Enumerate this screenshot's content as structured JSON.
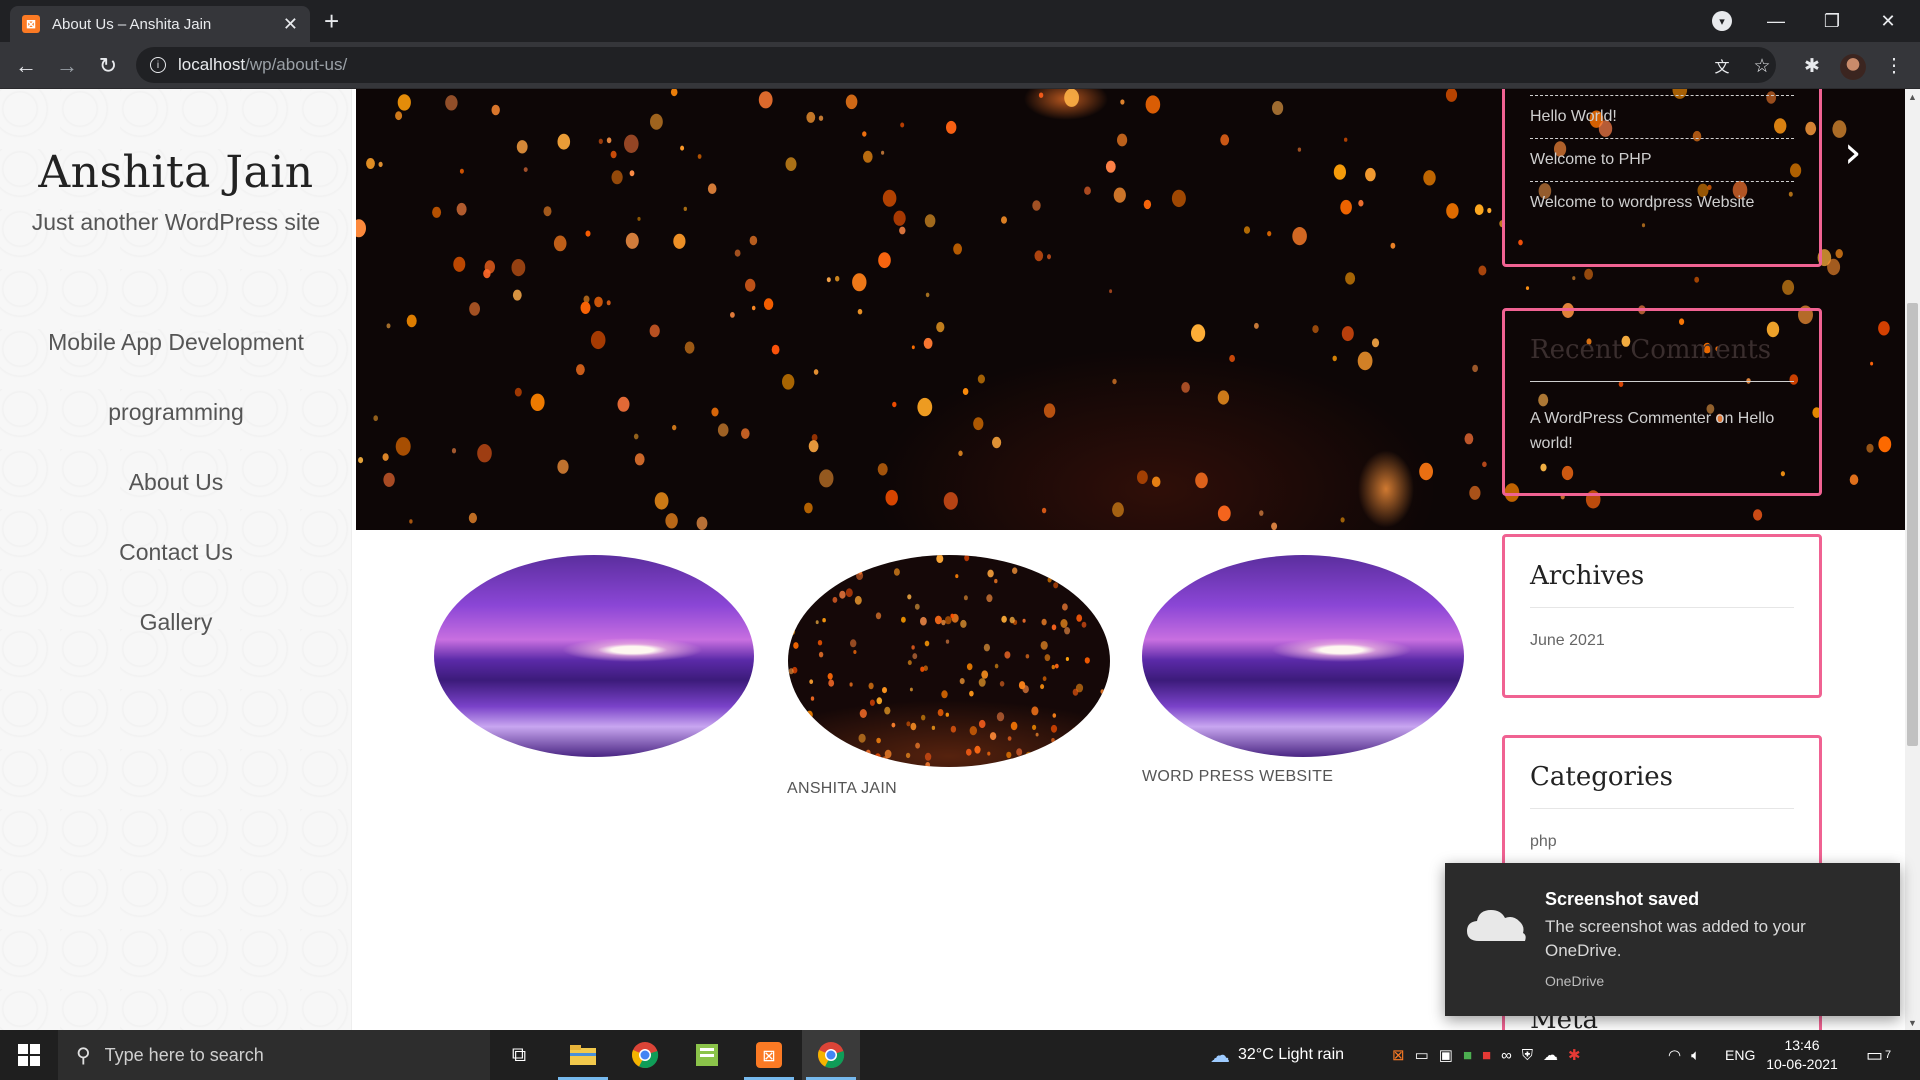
{
  "browser": {
    "tab_title": "About Us – Anshita Jain",
    "url_host": "localhost",
    "url_path": "/wp/about-us/"
  },
  "site": {
    "title": "Anshita Jain",
    "tagline": "Just another WordPress site"
  },
  "menu": [
    {
      "label": "Mobile App Development"
    },
    {
      "label": "programming"
    },
    {
      "label": "About Us"
    },
    {
      "label": "Contact Us"
    },
    {
      "label": "Gallery"
    }
  ],
  "gallery": {
    "captions": [
      "ANSHITA JAIN",
      "WORD PRESS WEBSITE"
    ]
  },
  "widgets": {
    "recent_posts": [
      "Hello World!",
      "Welcome to PHP",
      "Welcome to wordpress Website"
    ],
    "recent_comments": {
      "title": "Recent Comments",
      "author": "A WordPress Commenter",
      "on": "on",
      "post": "Hello world!"
    },
    "archives": {
      "title": "Archives",
      "items": [
        "June 2021"
      ]
    },
    "categories": {
      "title": "Categories",
      "items": [
        "php"
      ]
    },
    "meta": {
      "title": "Meta"
    }
  },
  "toast": {
    "title": "Screenshot saved",
    "message": "The screenshot was added to your OneDrive.",
    "source": "OneDrive"
  },
  "taskbar": {
    "search_placeholder": "Type here to search",
    "weather": "32°C  Light rain",
    "language": "ENG",
    "time": "13:46",
    "date": "10-06-2021",
    "notification_count": "7"
  },
  "colors": {
    "widget_border": "#f06292",
    "chrome_dark": "#202124",
    "chrome_toolbar": "#35363a",
    "taskbar": "#1f1f1f"
  }
}
